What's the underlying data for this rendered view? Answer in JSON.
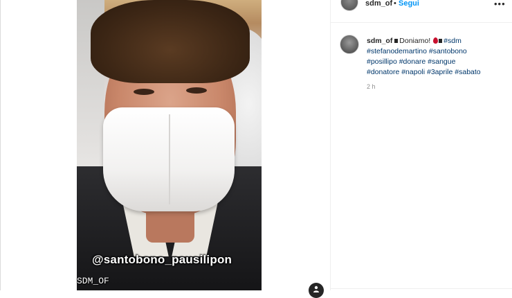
{
  "post": {
    "username": "sdm_of",
    "separator": "•",
    "follow_label": "Segui",
    "more_label": "•••"
  },
  "story": {
    "mention": "@santobono_pausilipon",
    "watermark": "SDM_OF",
    "tag_icon": "user-tag-icon"
  },
  "caption": {
    "username": "sdm_of",
    "text_start": "Doniamo!",
    "line1_tag": "#sdm",
    "line2": "#stefanodemartino #santobono",
    "line3": "#posillipo #donare #sangue",
    "line4": "#donatore #napoli #3aprile #sabato",
    "time": "2 h"
  },
  "colors": {
    "link": "#0095f6",
    "hashtag": "#00376b",
    "blood": "#c8102e"
  }
}
